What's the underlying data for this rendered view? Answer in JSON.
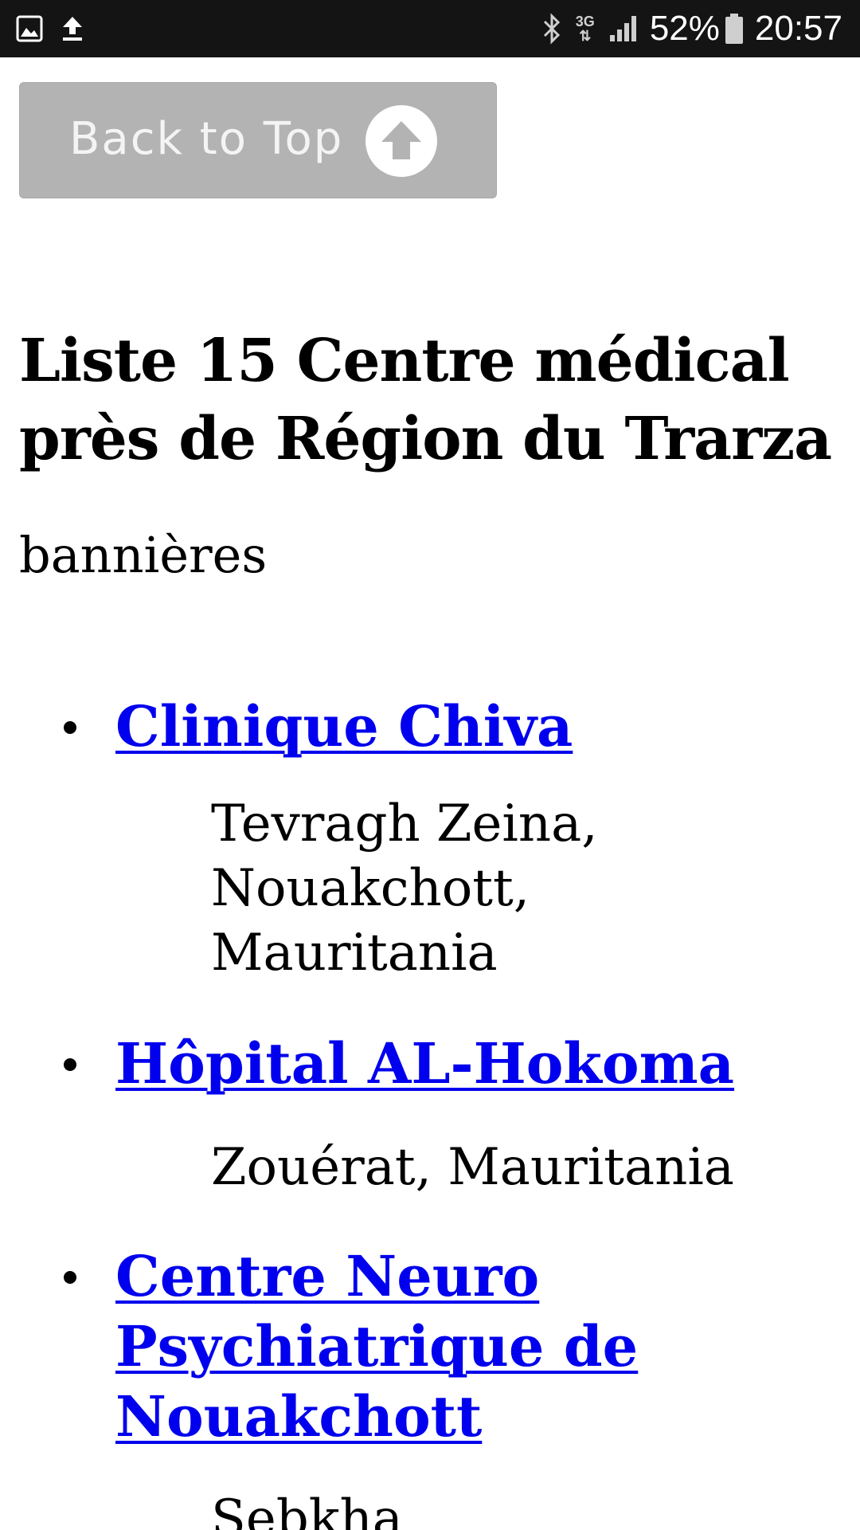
{
  "status_bar": {
    "icons_left": [
      "image-icon",
      "upload-icon"
    ],
    "icons_right": [
      "bluetooth-icon",
      "3g-icon",
      "signal-icon",
      "battery-icon"
    ],
    "network": "3G",
    "battery": "52%",
    "time": "20:57"
  },
  "back_to_top": {
    "label": "Back to Top",
    "icon": "arrow-up-circle-icon"
  },
  "page": {
    "title": "Liste 15 Centre médical près de Région du Trarza",
    "subtitle": "bannières"
  },
  "results": [
    {
      "name": "Clinique Chiva",
      "address": "Tevragh Zeina, Nouakchott, Mauritania"
    },
    {
      "name": "Hôpital AL-Hokoma",
      "address": "Zouérat, Mauritania"
    },
    {
      "name": "Centre Neuro Psychiatrique de Nouakchott",
      "address": "Sebkha"
    }
  ],
  "colors": {
    "status_bar_bg": "#141414",
    "link": "#0000ee",
    "back_to_top_bg": "#b3b3b3"
  }
}
